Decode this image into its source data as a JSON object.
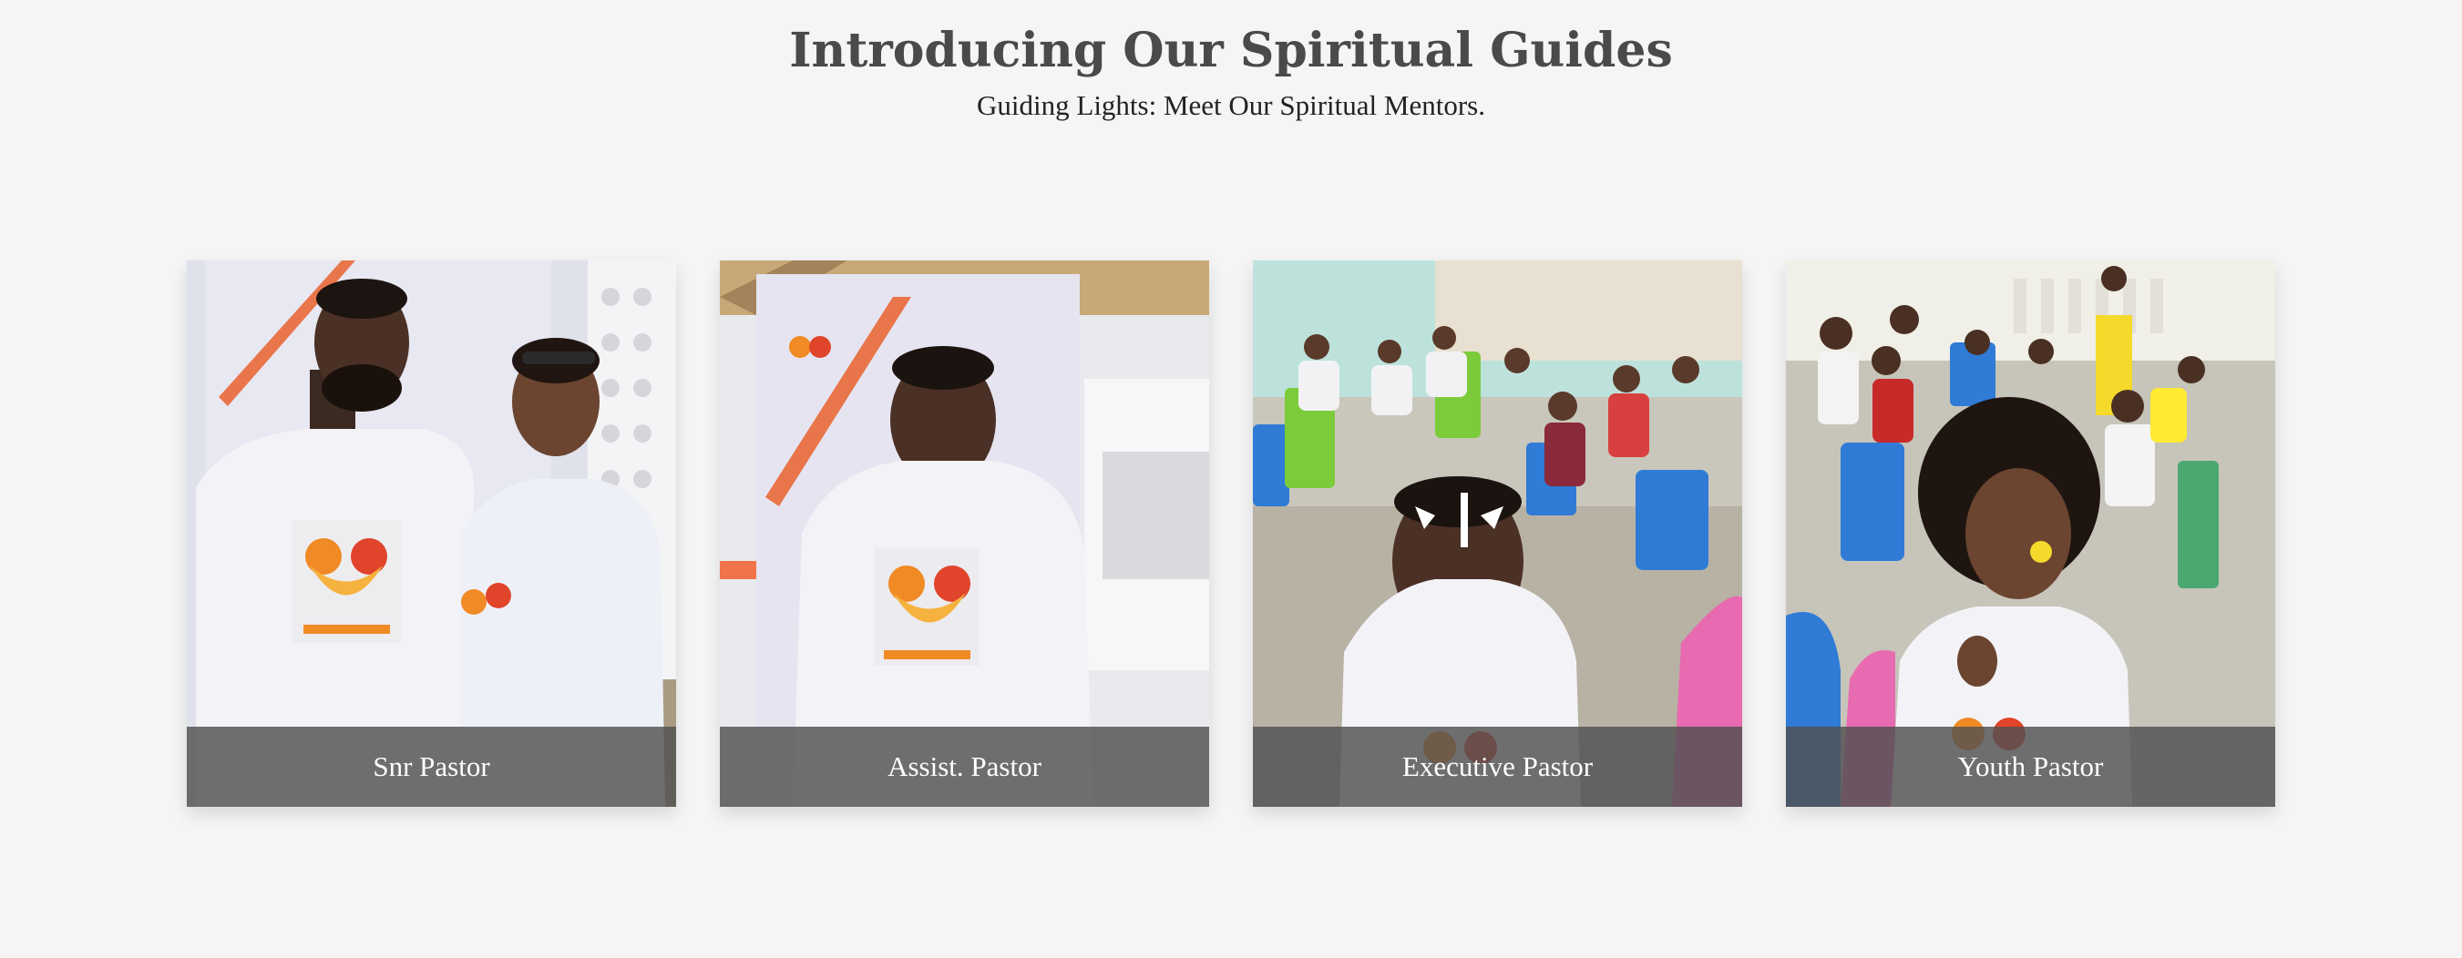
{
  "header": {
    "title": "Introducing Our Spiritual Guides",
    "subtitle": "Guiding Lights: Meet Our Spiritual Mentors."
  },
  "cards": [
    {
      "caption": "Snr Pastor",
      "photo": "two people in white foundation t-shirts photo"
    },
    {
      "caption": "Assist. Pastor",
      "photo": "man in white foundation t-shirt photo"
    },
    {
      "caption": "Executive Pastor",
      "photo": "man with face paint among children photo"
    },
    {
      "caption": "Youth Pastor",
      "photo": "woman with face paint among children photo"
    }
  ],
  "colors": {
    "background": "#f5f5f5",
    "title": "#4a4a4a",
    "caption_overlay": "#505050",
    "logo_orange": "#f08a24",
    "logo_red": "#e0442a"
  }
}
